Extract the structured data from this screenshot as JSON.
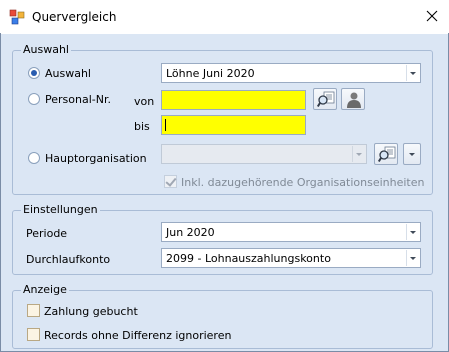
{
  "window": {
    "title": "Quervergleich",
    "close_icon": "close-icon"
  },
  "auswahl": {
    "group_label": "Auswahl",
    "radio_auswahl": {
      "label": "Auswahl",
      "checked": true
    },
    "auswahl_combo": {
      "value": "Löhne Juni 2020"
    },
    "radio_personal": {
      "label": "Personal-Nr.",
      "checked": false
    },
    "von_label": "von",
    "bis_label": "bis",
    "von_value": "",
    "bis_value": "",
    "radio_hauptorg": {
      "label": "Hauptorganisation",
      "checked": false
    },
    "hauptorg_combo": {
      "value": ""
    },
    "inkl_checkbox": {
      "label": "Inkl. dazugehörende Organisationseinheiten",
      "checked": true,
      "enabled": false
    }
  },
  "einstellungen": {
    "group_label": "Einstellungen",
    "periode_label": "Periode",
    "periode_value": "Jun 2020",
    "durchlauf_label": "Durchlaufkonto",
    "durchlauf_value": "2099 - Lohnauszahlungskonto"
  },
  "anzeige": {
    "group_label": "Anzeige",
    "zahlung_label": "Zahlung gebucht",
    "zahlung_checked": false,
    "records_label": "Records ohne Differenz ignorieren",
    "records_checked": false
  },
  "colors": {
    "window_bg": "#dbe6f4",
    "highlight_input": "#ffff00",
    "radio_selected": "#2a5db0"
  }
}
